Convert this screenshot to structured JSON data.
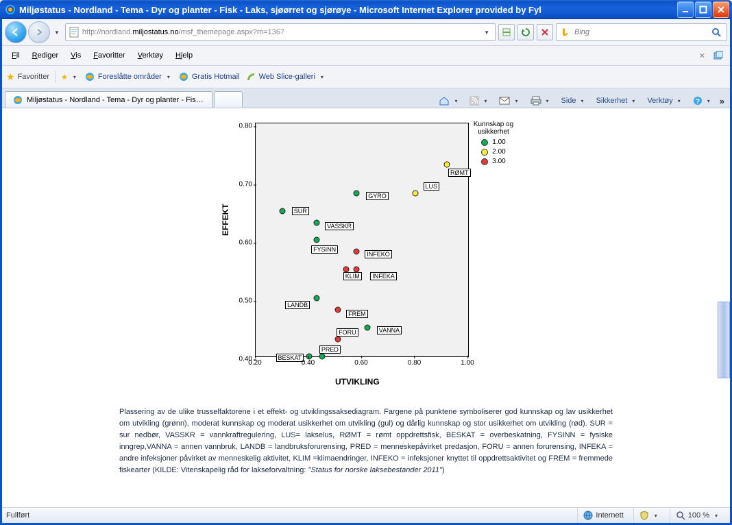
{
  "window": {
    "title": "Miljøstatus - Nordland - Tema - Dyr og planter - Fisk - Laks, sjøørret og sjørøye - Microsoft Internet Explorer provided by Fyl"
  },
  "address": {
    "scheme_host_path": "http://nordland.miljostatus.no/msf_themepage.aspx?m=1367",
    "prefix": "http://nordland.",
    "host": "miljostatus.no",
    "suffix": "/msf_themepage.aspx?m=1367"
  },
  "search": {
    "placeholder": "Bing"
  },
  "menubar": [
    "Fil",
    "Rediger",
    "Vis",
    "Favoritter",
    "Verktøy",
    "Hjelp"
  ],
  "favbar": {
    "button": "Favoritter",
    "links": [
      "Foreslåtte områder",
      "Gratis Hotmail",
      "Web Slice-galleri"
    ]
  },
  "tab": {
    "label": "Miljøstatus - Nordland - Tema - Dyr og planter - Fisk - ..."
  },
  "tabTools": [
    "Side",
    "Sikkerhet",
    "Verktøy"
  ],
  "status": {
    "left": "Fullført",
    "zone": "Internett",
    "zoom": "100 %"
  },
  "caption": {
    "body": "Plassering av de ulike trusselfaktorene i et effekt- og utviklingssaksediagram. Fargene på punktene symboliserer god kunnskap og lav usikkerhet om utvikling (grønn), moderat kunnskap og moderat usikkerhet om utvikling (gul) og dårlig kunnskap og stor usikkerhet om utvikling (rød). SUR = sur nedbør, VASSKR = vannkraftregulering, LUS= lakselus, RØMT = rømt oppdrettsfisk, BESKAT = overbeskatning, FYSINN = fysiske inngrep,VANNA = annen vannbruk, LANDB = landbruksforurensing, PRED = menneskepåvirket predasjon, FORU = annen forurensing, INFEKA = andre infeksjoner påvirket av menneskelig aktivitet, KLIM =klimaendringer, INFEKO = infeksjoner knyttet til oppdrettsaktivitet og FREM = fremmede fiskearter (KILDE: Vitenskapelig råd for lakseforvaltning: ",
    "source_italic": "\"Status for norske laksebestander 2011\"",
    "after": ")"
  },
  "chart_data": {
    "type": "scatter",
    "title": "",
    "xlabel": "UTVIKLING",
    "ylabel": "EFFEKT",
    "xlim": [
      0.2,
      1.0
    ],
    "ylim": [
      0.4,
      0.8
    ],
    "x_ticks": [
      0.2,
      0.4,
      0.6,
      0.8,
      1.0
    ],
    "y_ticks": [
      0.4,
      0.5,
      0.6,
      0.7,
      0.8
    ],
    "legend": {
      "title": "Kunnskap og usikkerhet",
      "items": [
        {
          "value": "1.00",
          "color": "#11aa55"
        },
        {
          "value": "2.00",
          "color": "#ffeb3b"
        },
        {
          "value": "3.00",
          "color": "#e53935"
        }
      ]
    },
    "points": [
      {
        "label": "SUR",
        "x": 0.3,
        "y": 0.65,
        "group": 1,
        "lab_dx": 10,
        "lab_dy": -2
      },
      {
        "label": "VASSKR",
        "x": 0.43,
        "y": 0.63,
        "group": 1,
        "lab_dx": 8,
        "lab_dy": 3
      },
      {
        "label": "FYSINN",
        "x": 0.43,
        "y": 0.6,
        "group": 1,
        "lab_dx": -12,
        "lab_dy": 12
      },
      {
        "label": "GYRO",
        "x": 0.58,
        "y": 0.68,
        "group": 1,
        "lab_dx": 10,
        "lab_dy": 2
      },
      {
        "label": "LANDB",
        "x": 0.43,
        "y": 0.5,
        "group": 1,
        "lab_dx": -50,
        "lab_dy": 8
      },
      {
        "label": "BESKAT",
        "x": 0.4,
        "y": 0.4,
        "group": 1,
        "lab_dx": -52,
        "lab_dy": 0
      },
      {
        "label": "PRED",
        "x": 0.45,
        "y": 0.4,
        "group": 1,
        "lab_dx": -8,
        "lab_dy": -12
      },
      {
        "label": "VANNA",
        "x": 0.62,
        "y": 0.45,
        "group": 1,
        "lab_dx": 10,
        "lab_dy": 2
      },
      {
        "label": "LUS",
        "x": 0.8,
        "y": 0.68,
        "group": 2,
        "lab_dx": 8,
        "lab_dy": -12
      },
      {
        "label": "RØMT",
        "x": 0.92,
        "y": 0.73,
        "group": 2,
        "lab_dx": -2,
        "lab_dy": 10
      },
      {
        "label": "FORU",
        "x": 0.51,
        "y": 0.43,
        "group": 3,
        "lab_dx": -6,
        "lab_dy": -12
      },
      {
        "label": "FREM",
        "x": 0.51,
        "y": 0.48,
        "group": 3,
        "lab_dx": 8,
        "lab_dy": 4
      },
      {
        "label": "KLIM",
        "x": 0.54,
        "y": 0.55,
        "group": 3,
        "lab_dx": -8,
        "lab_dy": 8
      },
      {
        "label": "INFEKA",
        "x": 0.58,
        "y": 0.55,
        "group": 3,
        "lab_dx": 16,
        "lab_dy": 8
      },
      {
        "label": "INFEKO",
        "x": 0.58,
        "y": 0.58,
        "group": 3,
        "lab_dx": 8,
        "lab_dy": 2
      }
    ]
  }
}
